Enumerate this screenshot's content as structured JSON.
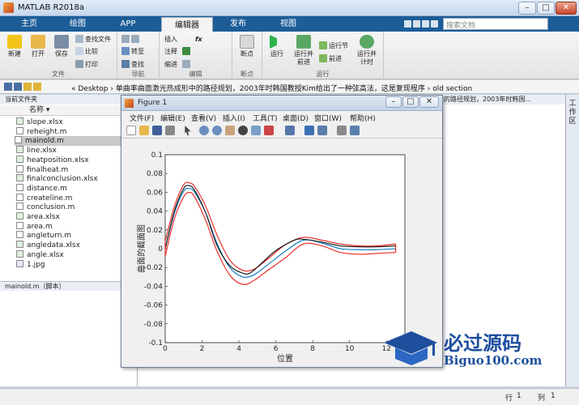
{
  "window": {
    "title": "MATLAB R2018a",
    "min": "–",
    "max": "□",
    "close": "✕"
  },
  "ribbon_tabs": [
    "主页",
    "绘图",
    "APP",
    "编辑器",
    "发布",
    "视图"
  ],
  "search_placeholder": "搜索文档",
  "ribbon": {
    "file": {
      "caption": "文件",
      "new": "新建",
      "open": "打开",
      "save": "保存",
      "find_files": "查找文件",
      "compare": "比较",
      "print": "打印"
    },
    "nav": {
      "caption": "导航",
      "goto": "转至",
      "find": "查找"
    },
    "edit": {
      "caption": "编辑",
      "insert": "插入",
      "comment": "注释",
      "indent": "缩进",
      "fx": "fx"
    },
    "breakpoints": {
      "caption": "断点",
      "bp": "断点"
    },
    "run": {
      "caption": "运行",
      "run": "运行",
      "run_advance": "运行并\n前进",
      "run_section": "运行节",
      "advance": "前进",
      "run_time": "运行并\n计时"
    }
  },
  "address": {
    "path": "« Desktop › 单曲率曲面激光热成形中的路径规划，2003年时韩国教授Kim给出了一种弦高法，这是复现程序 › old section"
  },
  "current_folder": {
    "header": "当前文件夹",
    "name_col": "名称 ▾",
    "files": [
      "slope.xlsx",
      "reheight.m",
      "mainold.m",
      "line.xlsx",
      "heatposition.xlsx",
      "finalheat.m",
      "finalconclusion.xlsx",
      "distance.m",
      "createline.m",
      "conclusion.m",
      "area.xlsx",
      "area.m",
      "angleturn.m",
      "angledata.xlsx",
      "angle.xlsx",
      "1.jpg"
    ],
    "selected": "mainold.m",
    "footer": "mainold.m（脚本）"
  },
  "right_header": "的路径规划，2003年时韩国...",
  "right_strip": "工作区",
  "status": {
    "row_label": "行",
    "row": "1",
    "col_label": "列",
    "col": "1"
  },
  "figure": {
    "title": "Figure 1",
    "menu": [
      "文件(F)",
      "编辑(E)",
      "查看(V)",
      "插入(I)",
      "工具(T)",
      "桌面(D)",
      "窗口(W)",
      "帮助(H)"
    ]
  },
  "chart_data": {
    "type": "line",
    "title": "",
    "xlabel": "位置",
    "ylabel": "曲面的截面图",
    "xlim": [
      0,
      13
    ],
    "ylim": [
      -0.1,
      0.1
    ],
    "xticks": [
      0,
      2,
      4,
      6,
      8,
      10,
      12
    ],
    "yticks": [
      -0.1,
      -0.08,
      -0.06,
      -0.04,
      -0.02,
      0,
      0.02,
      0.04,
      0.06,
      0.08,
      0.1
    ],
    "grid": false,
    "series": [
      {
        "color": "#e8201c",
        "x": [
          0,
          0.5,
          1.0,
          1.3,
          1.6,
          2.2,
          2.8,
          3.5,
          4.2,
          4.8,
          5.5,
          6.5,
          7.5,
          8.5,
          9.5,
          10.5,
          11.5,
          12.5
        ],
        "y": [
          0.008,
          0.045,
          0.068,
          0.07,
          0.066,
          0.045,
          0.015,
          -0.012,
          -0.023,
          -0.022,
          -0.012,
          0.004,
          0.012,
          0.009,
          0.005,
          0.003,
          0.003,
          0.005
        ]
      },
      {
        "color": "#e8201c",
        "x": [
          0,
          0.5,
          1.0,
          1.3,
          1.6,
          2.2,
          2.8,
          3.5,
          4.2,
          4.8,
          5.5,
          6.5,
          7.5,
          8.5,
          9.5,
          10.5,
          11.5,
          12.5
        ],
        "y": [
          -0.008,
          0.032,
          0.055,
          0.06,
          0.055,
          0.03,
          -0.002,
          -0.028,
          -0.038,
          -0.034,
          -0.024,
          -0.01,
          0.005,
          0.003,
          -0.004,
          -0.006,
          -0.005,
          -0.004
        ]
      },
      {
        "color": "#0072bd",
        "x": [
          0,
          0.5,
          1.0,
          1.3,
          1.6,
          2.2,
          2.8,
          3.5,
          4.2,
          4.8,
          5.5,
          6.5,
          7.5,
          8.5,
          9.5,
          10.5,
          11.5,
          12.5
        ],
        "y": [
          0,
          0.038,
          0.061,
          0.064,
          0.06,
          0.038,
          0.006,
          -0.02,
          -0.03,
          -0.028,
          -0.018,
          -0.003,
          0.009,
          0.006,
          0.0,
          -0.001,
          -0.001,
          0.0
        ]
      },
      {
        "color": "#111111",
        "x": [
          0,
          0.5,
          1.0,
          1.3,
          1.6,
          2.2,
          2.8,
          3.5,
          4.2,
          4.6,
          5.2,
          6.0,
          7.0,
          7.5,
          8.5,
          9.5,
          10.5,
          11.5,
          12.5
        ],
        "y": [
          0,
          0.04,
          0.064,
          0.067,
          0.062,
          0.038,
          0.004,
          -0.018,
          -0.026,
          -0.026,
          -0.016,
          -0.002,
          0.009,
          0.01,
          0.007,
          0.003,
          0.002,
          0.002,
          0.003
        ]
      }
    ]
  },
  "watermark": {
    "cn": "必过源码",
    "en": "Biguo100.com"
  }
}
